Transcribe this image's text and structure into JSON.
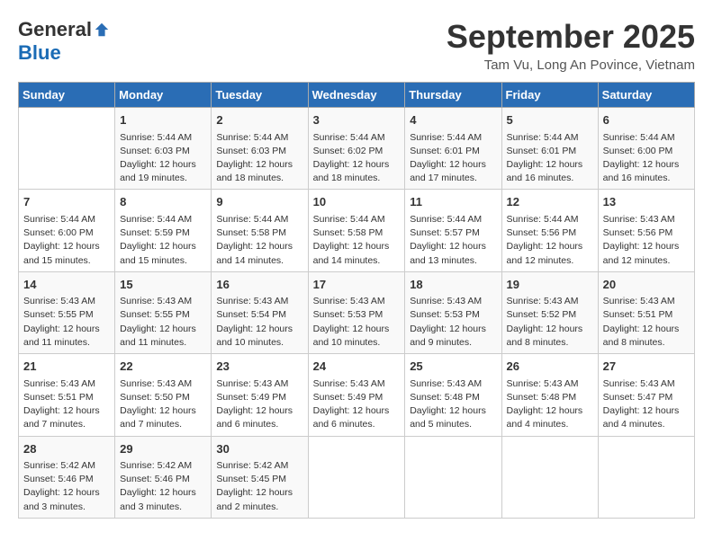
{
  "header": {
    "logo": {
      "general": "General",
      "blue": "Blue"
    },
    "title": "September 2025",
    "location": "Tam Vu, Long An Povince, Vietnam"
  },
  "calendar": {
    "days": [
      "Sunday",
      "Monday",
      "Tuesday",
      "Wednesday",
      "Thursday",
      "Friday",
      "Saturday"
    ],
    "weeks": [
      [
        {
          "num": "",
          "info": ""
        },
        {
          "num": "1",
          "info": "Sunrise: 5:44 AM\nSunset: 6:03 PM\nDaylight: 12 hours\nand 19 minutes."
        },
        {
          "num": "2",
          "info": "Sunrise: 5:44 AM\nSunset: 6:03 PM\nDaylight: 12 hours\nand 18 minutes."
        },
        {
          "num": "3",
          "info": "Sunrise: 5:44 AM\nSunset: 6:02 PM\nDaylight: 12 hours\nand 18 minutes."
        },
        {
          "num": "4",
          "info": "Sunrise: 5:44 AM\nSunset: 6:01 PM\nDaylight: 12 hours\nand 17 minutes."
        },
        {
          "num": "5",
          "info": "Sunrise: 5:44 AM\nSunset: 6:01 PM\nDaylight: 12 hours\nand 16 minutes."
        },
        {
          "num": "6",
          "info": "Sunrise: 5:44 AM\nSunset: 6:00 PM\nDaylight: 12 hours\nand 16 minutes."
        }
      ],
      [
        {
          "num": "7",
          "info": "Sunrise: 5:44 AM\nSunset: 6:00 PM\nDaylight: 12 hours\nand 15 minutes."
        },
        {
          "num": "8",
          "info": "Sunrise: 5:44 AM\nSunset: 5:59 PM\nDaylight: 12 hours\nand 15 minutes."
        },
        {
          "num": "9",
          "info": "Sunrise: 5:44 AM\nSunset: 5:58 PM\nDaylight: 12 hours\nand 14 minutes."
        },
        {
          "num": "10",
          "info": "Sunrise: 5:44 AM\nSunset: 5:58 PM\nDaylight: 12 hours\nand 14 minutes."
        },
        {
          "num": "11",
          "info": "Sunrise: 5:44 AM\nSunset: 5:57 PM\nDaylight: 12 hours\nand 13 minutes."
        },
        {
          "num": "12",
          "info": "Sunrise: 5:44 AM\nSunset: 5:56 PM\nDaylight: 12 hours\nand 12 minutes."
        },
        {
          "num": "13",
          "info": "Sunrise: 5:43 AM\nSunset: 5:56 PM\nDaylight: 12 hours\nand 12 minutes."
        }
      ],
      [
        {
          "num": "14",
          "info": "Sunrise: 5:43 AM\nSunset: 5:55 PM\nDaylight: 12 hours\nand 11 minutes."
        },
        {
          "num": "15",
          "info": "Sunrise: 5:43 AM\nSunset: 5:55 PM\nDaylight: 12 hours\nand 11 minutes."
        },
        {
          "num": "16",
          "info": "Sunrise: 5:43 AM\nSunset: 5:54 PM\nDaylight: 12 hours\nand 10 minutes."
        },
        {
          "num": "17",
          "info": "Sunrise: 5:43 AM\nSunset: 5:53 PM\nDaylight: 12 hours\nand 10 minutes."
        },
        {
          "num": "18",
          "info": "Sunrise: 5:43 AM\nSunset: 5:53 PM\nDaylight: 12 hours\nand 9 minutes."
        },
        {
          "num": "19",
          "info": "Sunrise: 5:43 AM\nSunset: 5:52 PM\nDaylight: 12 hours\nand 8 minutes."
        },
        {
          "num": "20",
          "info": "Sunrise: 5:43 AM\nSunset: 5:51 PM\nDaylight: 12 hours\nand 8 minutes."
        }
      ],
      [
        {
          "num": "21",
          "info": "Sunrise: 5:43 AM\nSunset: 5:51 PM\nDaylight: 12 hours\nand 7 minutes."
        },
        {
          "num": "22",
          "info": "Sunrise: 5:43 AM\nSunset: 5:50 PM\nDaylight: 12 hours\nand 7 minutes."
        },
        {
          "num": "23",
          "info": "Sunrise: 5:43 AM\nSunset: 5:49 PM\nDaylight: 12 hours\nand 6 minutes."
        },
        {
          "num": "24",
          "info": "Sunrise: 5:43 AM\nSunset: 5:49 PM\nDaylight: 12 hours\nand 6 minutes."
        },
        {
          "num": "25",
          "info": "Sunrise: 5:43 AM\nSunset: 5:48 PM\nDaylight: 12 hours\nand 5 minutes."
        },
        {
          "num": "26",
          "info": "Sunrise: 5:43 AM\nSunset: 5:48 PM\nDaylight: 12 hours\nand 4 minutes."
        },
        {
          "num": "27",
          "info": "Sunrise: 5:43 AM\nSunset: 5:47 PM\nDaylight: 12 hours\nand 4 minutes."
        }
      ],
      [
        {
          "num": "28",
          "info": "Sunrise: 5:42 AM\nSunset: 5:46 PM\nDaylight: 12 hours\nand 3 minutes."
        },
        {
          "num": "29",
          "info": "Sunrise: 5:42 AM\nSunset: 5:46 PM\nDaylight: 12 hours\nand 3 minutes."
        },
        {
          "num": "30",
          "info": "Sunrise: 5:42 AM\nSunset: 5:45 PM\nDaylight: 12 hours\nand 2 minutes."
        },
        {
          "num": "",
          "info": ""
        },
        {
          "num": "",
          "info": ""
        },
        {
          "num": "",
          "info": ""
        },
        {
          "num": "",
          "info": ""
        }
      ]
    ]
  }
}
